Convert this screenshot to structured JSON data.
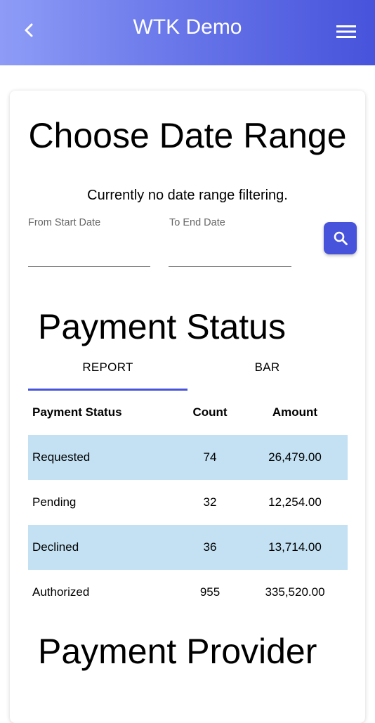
{
  "header": {
    "title": "WTK Demo",
    "back_icon": "chevron-left-icon",
    "menu_icon": "hamburger-menu-icon",
    "gradient_colors": [
      "#8e9cf7",
      "#4753db"
    ]
  },
  "date_range": {
    "heading": "Choose Date Range",
    "status": "Currently no date range filtering.",
    "start_label": "From Start Date",
    "end_label": "To End Date",
    "start_value": "",
    "end_value": "",
    "search_icon": "search-icon",
    "accent_color": "#4753db"
  },
  "payment_status": {
    "heading": "Payment Status",
    "tabs": [
      {
        "label": "REPORT",
        "active": true
      },
      {
        "label": "BAR",
        "active": false
      }
    ],
    "columns": [
      "Payment Status",
      "Count",
      "Amount"
    ],
    "rows": [
      {
        "status": "Requested",
        "count": "74",
        "amount": "26,479.00",
        "shaded": true
      },
      {
        "status": "Pending",
        "count": "32",
        "amount": "12,254.00",
        "shaded": false
      },
      {
        "status": "Declined",
        "count": "36",
        "amount": "13,714.00",
        "shaded": true
      },
      {
        "status": "Authorized",
        "count": "955",
        "amount": "335,520.00",
        "shaded": false
      }
    ],
    "row_highlight_color": "#c3e1f3"
  },
  "payment_provider": {
    "heading": "Payment Provider"
  }
}
